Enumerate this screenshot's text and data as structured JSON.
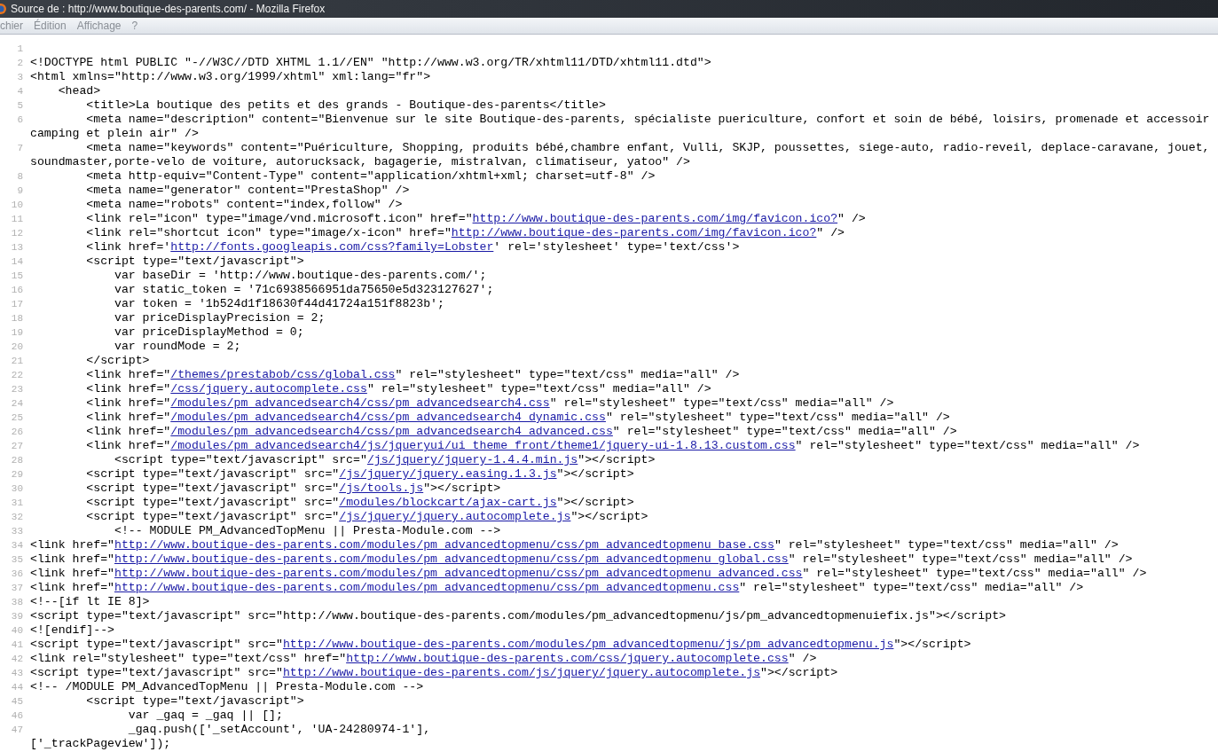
{
  "window": {
    "title": "Source de : http://www.boutique-des-parents.com/ - Mozilla Firefox"
  },
  "menu": [
    {
      "label": "chier"
    },
    {
      "label": "Édition"
    },
    {
      "label": "Affichage"
    },
    {
      "label": "?"
    }
  ],
  "lines": [
    {
      "number": "1"
    },
    {
      "number": "2",
      "segments": [
        {
          "kind": "text",
          "text": "<!DOCTYPE html PUBLIC \"-//W3C//DTD XHTML 1.1//EN\" \"http://www.w3.org/TR/xhtml11/DTD/xhtml11.dtd\">"
        }
      ]
    },
    {
      "number": "3",
      "segments": [
        {
          "kind": "text",
          "text": "<html xmlns=\"http://www.w3.org/1999/xhtml\" xml:lang=\"fr\">"
        }
      ]
    },
    {
      "number": "4",
      "segments": [
        {
          "kind": "text",
          "text": "    <head>"
        }
      ]
    },
    {
      "number": "5",
      "segments": [
        {
          "kind": "text",
          "text": "        <title>La boutique des petits et des grands - Boutique-des-parents</title>"
        }
      ]
    },
    {
      "number": "6",
      "segments": [
        {
          "kind": "text",
          "text": "        <meta name=\"description\" content=\"Bienvenue sur le site Boutique-des-parents, spécialiste puericulture, confort et soin de bébé, loisirs, promenade et accessoir"
        }
      ],
      "wrap": "camping et plein air\" />"
    },
    {
      "number": "7",
      "segments": [
        {
          "kind": "text",
          "text": "        <meta name=\"keywords\" content=\"Puériculture, Shopping, produits bébé,chambre enfant, Vulli, SKJP, poussettes, siege-auto, radio-reveil, deplace-caravane, jouet,"
        }
      ],
      "wrap": "soundmaster,porte-velo de voiture, autorucksack, bagagerie, mistralvan, climatiseur, yatoo\" />"
    },
    {
      "number": "8",
      "segments": [
        {
          "kind": "text",
          "text": "        <meta http-equiv=\"Content-Type\" content=\"application/xhtml+xml; charset=utf-8\" />"
        }
      ]
    },
    {
      "number": "9",
      "segments": [
        {
          "kind": "text",
          "text": "        <meta name=\"generator\" content=\"PrestaShop\" />"
        }
      ]
    },
    {
      "number": "10",
      "segments": [
        {
          "kind": "text",
          "text": "        <meta name=\"robots\" content=\"index,follow\" />"
        }
      ]
    },
    {
      "number": "11",
      "segments": [
        {
          "kind": "text",
          "text": "        <link rel=\"icon\" type=\"image/vnd.microsoft.icon\" href=\""
        },
        {
          "kind": "link",
          "text": "http://www.boutique-des-parents.com/img/favicon.ico?"
        },
        {
          "kind": "text",
          "text": "\" />"
        }
      ]
    },
    {
      "number": "12",
      "segments": [
        {
          "kind": "text",
          "text": "        <link rel=\"shortcut icon\" type=\"image/x-icon\" href=\""
        },
        {
          "kind": "link",
          "text": "http://www.boutique-des-parents.com/img/favicon.ico?"
        },
        {
          "kind": "text",
          "text": "\" />"
        }
      ]
    },
    {
      "number": "13",
      "segments": [
        {
          "kind": "text",
          "text": "        <link href='"
        },
        {
          "kind": "link",
          "text": "http://fonts.googleapis.com/css?family=Lobster"
        },
        {
          "kind": "text",
          "text": "' rel='stylesheet' type='text/css'>"
        }
      ]
    },
    {
      "number": "14",
      "segments": [
        {
          "kind": "text",
          "text": "        <script type=\"text/javascript\">"
        }
      ]
    },
    {
      "number": "15",
      "segments": [
        {
          "kind": "text",
          "text": "            var baseDir = 'http://www.boutique-des-parents.com/';"
        }
      ]
    },
    {
      "number": "16",
      "segments": [
        {
          "kind": "text",
          "text": "            var static_token = '71c6938566951da75650e5d323127627';"
        }
      ]
    },
    {
      "number": "17",
      "segments": [
        {
          "kind": "text",
          "text": "            var token = '1b524d1f18630f44d41724a151f8823b';"
        }
      ]
    },
    {
      "number": "18",
      "segments": [
        {
          "kind": "text",
          "text": "            var priceDisplayPrecision = 2;"
        }
      ]
    },
    {
      "number": "19",
      "segments": [
        {
          "kind": "text",
          "text": "            var priceDisplayMethod = 0;"
        }
      ]
    },
    {
      "number": "20",
      "segments": [
        {
          "kind": "text",
          "text": "            var roundMode = 2;"
        }
      ]
    },
    {
      "number": "21",
      "segments": [
        {
          "kind": "text",
          "text": "        </script>"
        }
      ]
    },
    {
      "number": "22",
      "segments": [
        {
          "kind": "text",
          "text": "        <link href=\""
        },
        {
          "kind": "link",
          "text": "/themes/prestabob/css/global.css"
        },
        {
          "kind": "text",
          "text": "\" rel=\"stylesheet\" type=\"text/css\" media=\"all\" />"
        }
      ]
    },
    {
      "number": "23",
      "segments": [
        {
          "kind": "text",
          "text": "        <link href=\""
        },
        {
          "kind": "link",
          "text": "/css/jquery.autocomplete.css"
        },
        {
          "kind": "text",
          "text": "\" rel=\"stylesheet\" type=\"text/css\" media=\"all\" />"
        }
      ]
    },
    {
      "number": "24",
      "segments": [
        {
          "kind": "text",
          "text": "        <link href=\""
        },
        {
          "kind": "link",
          "text": "/modules/pm_advancedsearch4/css/pm_advancedsearch4.css"
        },
        {
          "kind": "text",
          "text": "\" rel=\"stylesheet\" type=\"text/css\" media=\"all\" />"
        }
      ]
    },
    {
      "number": "25",
      "segments": [
        {
          "kind": "text",
          "text": "        <link href=\""
        },
        {
          "kind": "link",
          "text": "/modules/pm_advancedsearch4/css/pm_advancedsearch4_dynamic.css"
        },
        {
          "kind": "text",
          "text": "\" rel=\"stylesheet\" type=\"text/css\" media=\"all\" />"
        }
      ]
    },
    {
      "number": "26",
      "segments": [
        {
          "kind": "text",
          "text": "        <link href=\""
        },
        {
          "kind": "link",
          "text": "/modules/pm_advancedsearch4/css/pm_advancedsearch4_advanced.css"
        },
        {
          "kind": "text",
          "text": "\" rel=\"stylesheet\" type=\"text/css\" media=\"all\" />"
        }
      ]
    },
    {
      "number": "27",
      "segments": [
        {
          "kind": "text",
          "text": "        <link href=\""
        },
        {
          "kind": "link",
          "text": "/modules/pm_advancedsearch4/js/jqueryui/ui_theme_front/theme1/jquery-ui-1.8.13.custom.css"
        },
        {
          "kind": "text",
          "text": "\" rel=\"stylesheet\" type=\"text/css\" media=\"all\" />"
        }
      ]
    },
    {
      "number": "28",
      "segments": [
        {
          "kind": "text",
          "text": "            <script type=\"text/javascript\" src=\""
        },
        {
          "kind": "link",
          "text": "/js/jquery/jquery-1.4.4.min.js"
        },
        {
          "kind": "text",
          "text": "\"></script>"
        }
      ]
    },
    {
      "number": "29",
      "segments": [
        {
          "kind": "text",
          "text": "        <script type=\"text/javascript\" src=\""
        },
        {
          "kind": "link",
          "text": "/js/jquery/jquery.easing.1.3.js"
        },
        {
          "kind": "text",
          "text": "\"></script>"
        }
      ]
    },
    {
      "number": "30",
      "segments": [
        {
          "kind": "text",
          "text": "        <script type=\"text/javascript\" src=\""
        },
        {
          "kind": "link",
          "text": "/js/tools.js"
        },
        {
          "kind": "text",
          "text": "\"></script>"
        }
      ]
    },
    {
      "number": "31",
      "segments": [
        {
          "kind": "text",
          "text": "        <script type=\"text/javascript\" src=\""
        },
        {
          "kind": "link",
          "text": "/modules/blockcart/ajax-cart.js"
        },
        {
          "kind": "text",
          "text": "\"></script>"
        }
      ]
    },
    {
      "number": "32",
      "segments": [
        {
          "kind": "text",
          "text": "        <script type=\"text/javascript\" src=\""
        },
        {
          "kind": "link",
          "text": "/js/jquery/jquery.autocomplete.js"
        },
        {
          "kind": "text",
          "text": "\"></script>"
        }
      ]
    },
    {
      "number": "33",
      "segments": [
        {
          "kind": "text",
          "text": "            <!-- MODULE PM_AdvancedTopMenu || Presta-Module.com -->"
        }
      ]
    },
    {
      "number": "34",
      "segments": [
        {
          "kind": "text",
          "text": "<link href=\""
        },
        {
          "kind": "link",
          "text": "http://www.boutique-des-parents.com/modules/pm_advancedtopmenu/css/pm_advancedtopmenu_base.css"
        },
        {
          "kind": "text",
          "text": "\" rel=\"stylesheet\" type=\"text/css\" media=\"all\" />"
        }
      ]
    },
    {
      "number": "35",
      "segments": [
        {
          "kind": "text",
          "text": "<link href=\""
        },
        {
          "kind": "link",
          "text": "http://www.boutique-des-parents.com/modules/pm_advancedtopmenu/css/pm_advancedtopmenu_global.css"
        },
        {
          "kind": "text",
          "text": "\" rel=\"stylesheet\" type=\"text/css\" media=\"all\" />"
        }
      ]
    },
    {
      "number": "36",
      "segments": [
        {
          "kind": "text",
          "text": "<link href=\""
        },
        {
          "kind": "link",
          "text": "http://www.boutique-des-parents.com/modules/pm_advancedtopmenu/css/pm_advancedtopmenu_advanced.css"
        },
        {
          "kind": "text",
          "text": "\" rel=\"stylesheet\" type=\"text/css\" media=\"all\" />"
        }
      ]
    },
    {
      "number": "37",
      "segments": [
        {
          "kind": "text",
          "text": "<link href=\""
        },
        {
          "kind": "link",
          "text": "http://www.boutique-des-parents.com/modules/pm_advancedtopmenu/css/pm_advancedtopmenu.css"
        },
        {
          "kind": "text",
          "text": "\" rel=\"stylesheet\" type=\"text/css\" media=\"all\" />"
        }
      ]
    },
    {
      "number": "38",
      "segments": [
        {
          "kind": "text",
          "text": "<!--[if lt IE 8]>"
        }
      ]
    },
    {
      "number": "39",
      "segments": [
        {
          "kind": "text",
          "text": "<script type=\"text/javascript\" src=\"http://www.boutique-des-parents.com/modules/pm_advancedtopmenu/js/pm_advancedtopmenuiefix.js\"></script>"
        }
      ]
    },
    {
      "number": "40",
      "segments": [
        {
          "kind": "text",
          "text": "<![endif]-->"
        }
      ]
    },
    {
      "number": "41",
      "segments": [
        {
          "kind": "text",
          "text": "<script type=\"text/javascript\" src=\""
        },
        {
          "kind": "link",
          "text": "http://www.boutique-des-parents.com/modules/pm_advancedtopmenu/js/pm_advancedtopmenu.js"
        },
        {
          "kind": "text",
          "text": "\"></script>"
        }
      ]
    },
    {
      "number": "42",
      "segments": [
        {
          "kind": "text",
          "text": "<link rel=\"stylesheet\" type=\"text/css\" href=\""
        },
        {
          "kind": "link",
          "text": "http://www.boutique-des-parents.com/css/jquery.autocomplete.css"
        },
        {
          "kind": "text",
          "text": "\" />"
        }
      ]
    },
    {
      "number": "43",
      "segments": [
        {
          "kind": "text",
          "text": "<script type=\"text/javascript\" src=\""
        },
        {
          "kind": "link",
          "text": "http://www.boutique-des-parents.com/js/jquery/jquery.autocomplete.js"
        },
        {
          "kind": "text",
          "text": "\"></script>"
        }
      ]
    },
    {
      "number": "44",
      "segments": [
        {
          "kind": "text",
          "text": "<!-- /MODULE PM_AdvancedTopMenu || Presta-Module.com -->"
        }
      ]
    },
    {
      "number": "45",
      "segments": [
        {
          "kind": "text",
          "text": "        <script type=\"text/javascript\">"
        }
      ]
    },
    {
      "number": "46",
      "segments": [
        {
          "kind": "text",
          "text": "              var _gaq = _gaq || [];"
        }
      ]
    },
    {
      "number": "47",
      "segments": [
        {
          "kind": "text",
          "text": "              _gaq.push(['_setAccount', 'UA-24280974-1'],"
        }
      ],
      "wrap": "['_trackPageview']);"
    }
  ]
}
